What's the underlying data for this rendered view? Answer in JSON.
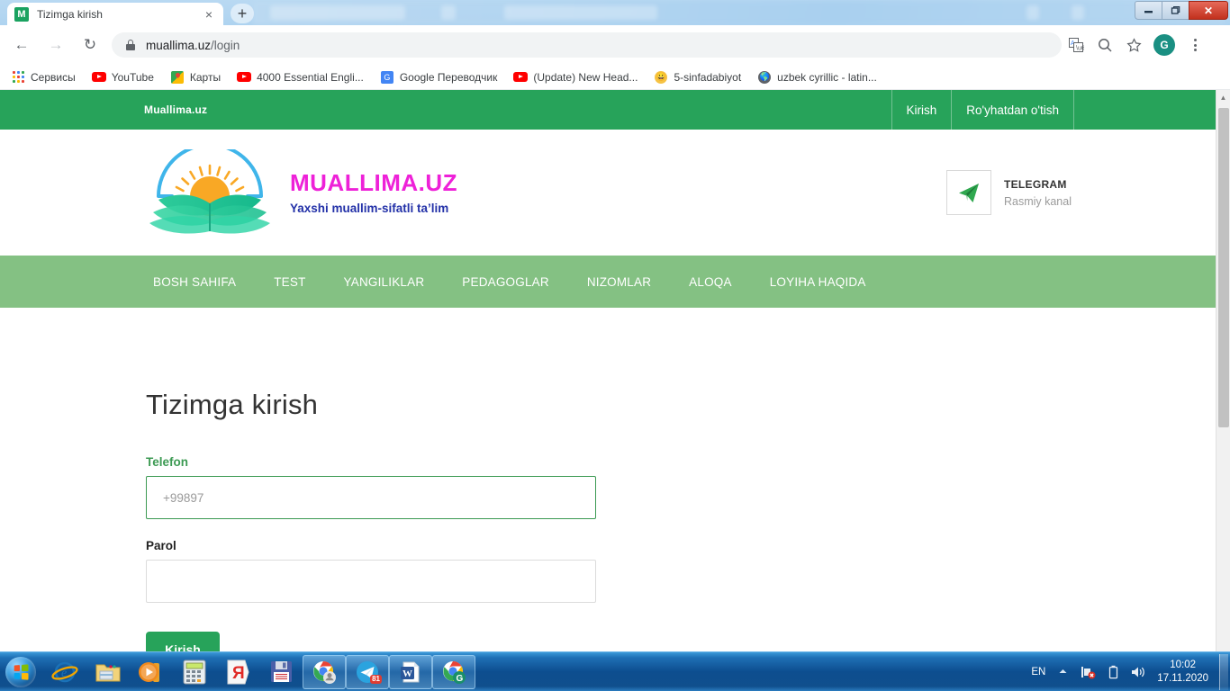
{
  "browser": {
    "tab": {
      "title": "Tizimga kirish",
      "favicon_letter": "M",
      "close_label": "×"
    },
    "newtab_label": "+",
    "window_controls": {
      "minimize": "—",
      "restore": "❐",
      "close": "✕"
    },
    "nav": {
      "back": "←",
      "forward": "→",
      "reload": "↻"
    },
    "omnibox": {
      "url_domain": "muallima.uz",
      "url_path": "/login",
      "lock": "lock-icon"
    },
    "toolbar_right": {
      "translate": "translate-icon",
      "zoom": "zoom-out-icon",
      "bookmark": "star-icon",
      "profile_letter": "G",
      "menu": "kebab-menu-icon"
    },
    "bookmarks": [
      {
        "label": "Сервисы",
        "icon": "apps-grid-icon"
      },
      {
        "label": "YouTube",
        "icon": "youtube-icon"
      },
      {
        "label": "Карты",
        "icon": "google-maps-icon"
      },
      {
        "label": "4000 Essential Engli...",
        "icon": "youtube-icon"
      },
      {
        "label": "Google Переводчик",
        "icon": "google-translate-icon"
      },
      {
        "label": "(Update) New Head...",
        "icon": "youtube-icon"
      },
      {
        "label": "5-sinfadabiyot",
        "icon": "smiley-icon"
      },
      {
        "label": "uzbek cyrillic - latin...",
        "icon": "globe-icon"
      }
    ]
  },
  "site": {
    "topbar": {
      "brand": "Muallima.uz",
      "links": [
        {
          "label": "Kirish"
        },
        {
          "label": "Ro'yhatdan o'tish"
        }
      ]
    },
    "logo": {
      "title": "MUALLIMA.UZ",
      "subtitle": "Yaxshi muallim-sifatli ta’lim",
      "mark": "sunrise-book-logo-icon"
    },
    "telegram": {
      "icon": "telegram-paper-plane-icon",
      "title": "TELEGRAM",
      "subtitle": "Rasmiy kanal"
    },
    "menu": [
      {
        "label": "BOSH SAHIFA"
      },
      {
        "label": "TEST"
      },
      {
        "label": "YANGILIKLAR"
      },
      {
        "label": "PEDAGOGLAR"
      },
      {
        "label": "NIZOMLAR"
      },
      {
        "label": "ALOQA"
      },
      {
        "label": "LOYIHA HAQIDA"
      }
    ],
    "login": {
      "title": "Tizimga kirish",
      "phone_label": "Telefon",
      "phone_placeholder": "+99897",
      "phone_value": "",
      "password_label": "Parol",
      "password_value": "",
      "submit_label": "Kirish"
    },
    "colors": {
      "topbar_green": "#27a35a",
      "menu_green": "#84c183",
      "logo_magenta": "#ee21d8",
      "logo_blue": "#2331a8",
      "label_green": "#3c9a53"
    }
  },
  "taskbar": {
    "start": "windows-start-orb",
    "items": [
      {
        "name": "internet-explorer-icon",
        "running": false,
        "badge": ""
      },
      {
        "name": "windows-explorer-icon",
        "running": false,
        "badge": ""
      },
      {
        "name": "media-player-icon",
        "running": false,
        "badge": ""
      },
      {
        "name": "calculator-icon",
        "running": false,
        "badge": ""
      },
      {
        "name": "yandex-browser-icon",
        "running": false,
        "badge": ""
      },
      {
        "name": "save-floppy-icon",
        "running": false,
        "badge": ""
      },
      {
        "name": "chrome-profile-icon",
        "running": true,
        "badge": ""
      },
      {
        "name": "telegram-icon",
        "running": true,
        "badge": "81"
      },
      {
        "name": "word-icon",
        "running": true,
        "badge": ""
      },
      {
        "name": "chrome-google-icon",
        "running": true,
        "badge": ""
      }
    ],
    "tray": {
      "language": "EN",
      "show_hidden": "▲",
      "network": "network-disconnected-icon",
      "battery": "battery-icon",
      "volume": "speaker-icon",
      "time": "10:02",
      "date": "17.11.2020"
    }
  }
}
